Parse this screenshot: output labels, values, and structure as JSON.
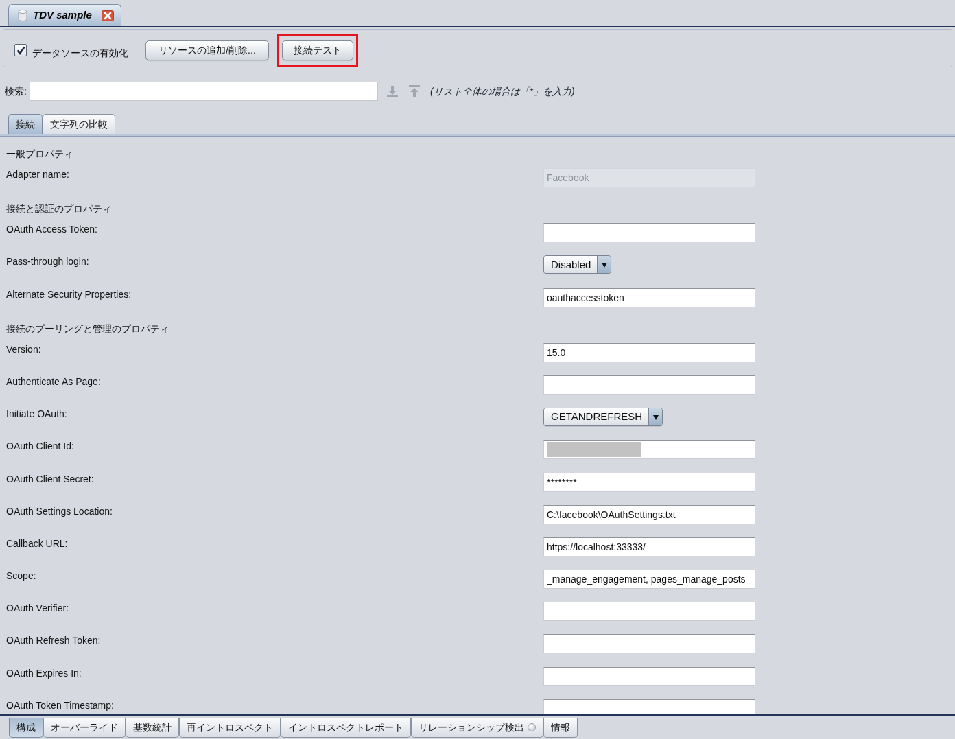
{
  "document_tabs": [
    {
      "label": "TDV sample",
      "selected": true
    }
  ],
  "toolbar": {
    "enable_checkbox": {
      "label": "データソースの有効化",
      "checked": true
    },
    "buttons": [
      {
        "label": "リソースの追加/削除...",
        "highlighted": false
      },
      {
        "label": "接続テスト",
        "highlighted": true
      }
    ]
  },
  "search": {
    "label": "検索:",
    "hint": "(リスト全体の場合は「*」を入力)"
  },
  "sub_tabs": [
    {
      "label": "接続",
      "selected": true
    },
    {
      "label": "文字列の比較",
      "selected": false
    }
  ],
  "form": [
    {
      "kind": "heading",
      "label": "一般プロパティ"
    },
    {
      "kind": "text",
      "label": "Adapter name:",
      "value": "Facebook",
      "disabled": true
    },
    {
      "kind": "heading",
      "label": "接続と認証のプロパティ"
    },
    {
      "kind": "text",
      "label": "OAuth Access Token:",
      "disabled": false
    },
    {
      "kind": "select",
      "label": "Pass-through login:",
      "value": "Disabled",
      "disabled": false
    },
    {
      "kind": "text",
      "label": "Alternate Security Properties:",
      "value": "oauthaccesstoken",
      "disabled": false
    },
    {
      "kind": "heading",
      "label": "接続のプーリングと管理のプロパティ"
    },
    {
      "kind": "text",
      "label": "Version:",
      "value": "15.0",
      "disabled": false
    },
    {
      "kind": "text",
      "label": "Authenticate As Page:",
      "disabled": false
    },
    {
      "kind": "select",
      "label": "Initiate OAuth:",
      "value": "GETANDREFRESH",
      "disabled": false
    },
    {
      "kind": "redacted",
      "label": "OAuth Client Id:",
      "disabled": false
    },
    {
      "kind": "text",
      "label": "OAuth Client Secret:",
      "value": "********",
      "disabled": false
    },
    {
      "kind": "text",
      "label": "OAuth Settings Location:",
      "value": "C:\\facebook\\OAuthSettings.txt",
      "disabled": false
    },
    {
      "kind": "text",
      "label": "Callback URL:",
      "value": "https://localhost:33333/",
      "disabled": false
    },
    {
      "kind": "text",
      "label": "Scope:",
      "value": "_manage_engagement, pages_manage_posts",
      "disabled": false
    },
    {
      "kind": "text",
      "label": "OAuth Verifier:",
      "disabled": false
    },
    {
      "kind": "text",
      "label": "OAuth Refresh Token:",
      "disabled": false
    },
    {
      "kind": "text",
      "label": "OAuth Expires In:",
      "disabled": false
    },
    {
      "kind": "text",
      "label": "OAuth Token Timestamp:",
      "disabled": false
    }
  ],
  "bottom_tabs": [
    {
      "label": "構成",
      "selected": true,
      "kind": "plain"
    },
    {
      "label": "オーバーライド",
      "selected": false,
      "kind": "plain"
    },
    {
      "label": "基数統計",
      "selected": false,
      "kind": "plain"
    },
    {
      "label": "再イントロスペクト",
      "selected": false,
      "kind": "plain"
    },
    {
      "label": "イントロスペクトレポート",
      "selected": false,
      "kind": "plain"
    },
    {
      "label": "リレーションシップ検出",
      "selected": false,
      "kind": "indicator"
    },
    {
      "label": "情報",
      "selected": false,
      "kind": "plain"
    }
  ]
}
